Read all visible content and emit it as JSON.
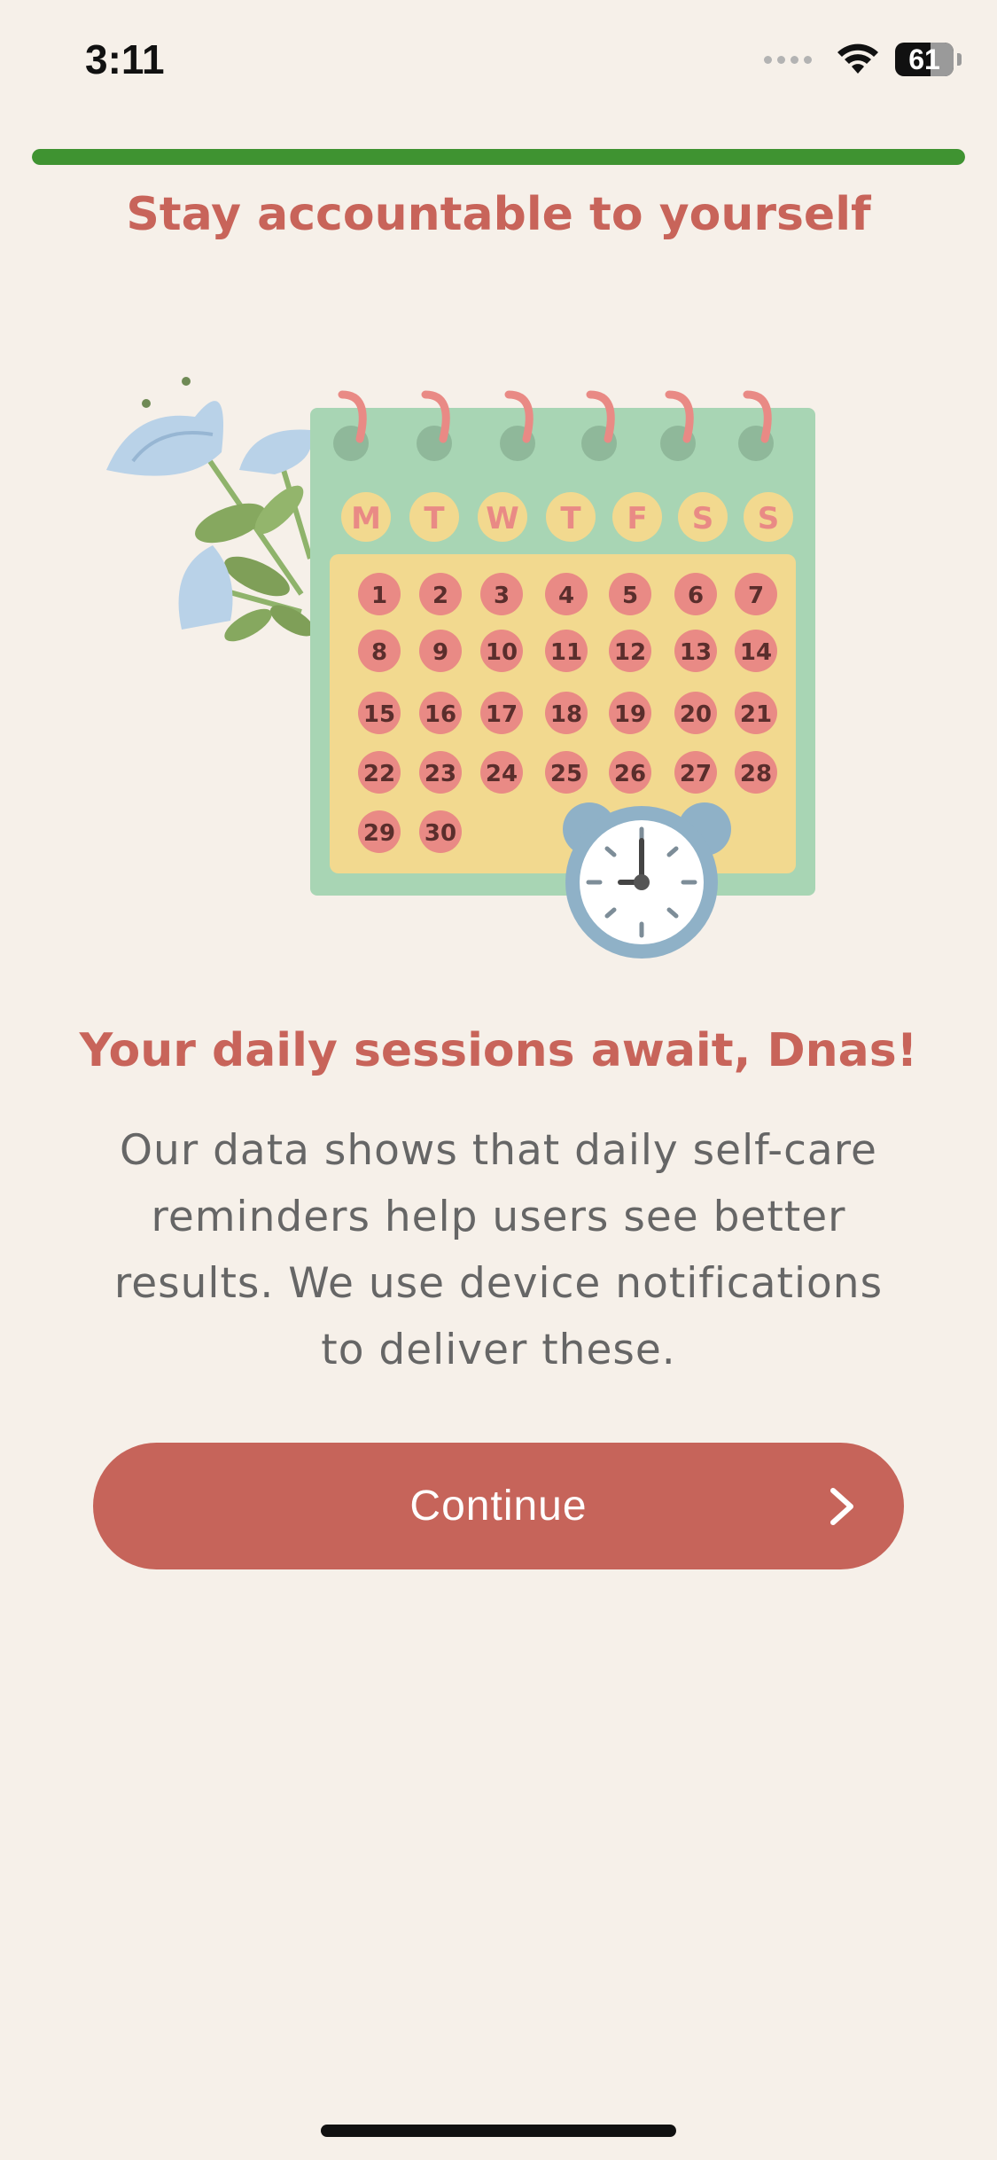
{
  "status_bar": {
    "time": "3:11",
    "battery": "61",
    "icons": [
      "signal-dots-icon",
      "wifi-icon",
      "battery-icon"
    ]
  },
  "progress": {
    "fraction": 1.0,
    "color": "#3f9331"
  },
  "header": {
    "title": "Stay accountable to yourself"
  },
  "illustration": {
    "weekdays": [
      "M",
      "T",
      "W",
      "T",
      "F",
      "S",
      "S"
    ],
    "days": [
      "1",
      "2",
      "3",
      "4",
      "5",
      "6",
      "7",
      "8",
      "9",
      "10",
      "11",
      "12",
      "13",
      "14",
      "15",
      "16",
      "17",
      "18",
      "19",
      "20",
      "21",
      "22",
      "23",
      "24",
      "25",
      "26",
      "27",
      "28",
      "29",
      "30"
    ]
  },
  "content": {
    "headline": "Your daily sessions await, Dnas!",
    "body": "Our data shows that daily self-care reminders help users see better results. We use device notifications to deliver these."
  },
  "actions": {
    "continue_label": "Continue"
  },
  "colors": {
    "background": "#f6f0e9",
    "accent": "#c6645a",
    "calendar_green": "#a8d5b4",
    "calendar_yellow": "#f2d98f",
    "day_pink": "#e98a85"
  }
}
